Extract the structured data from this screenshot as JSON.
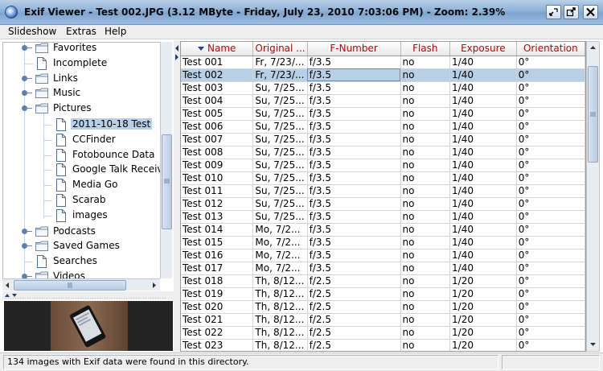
{
  "window": {
    "title": "Exif Viewer - Test 002.JPG  (3.12 MByte  - Friday, July 23, 2010  7:03:06 PM)  - Zoom: 2.39%"
  },
  "menu": {
    "items": [
      "Slideshow",
      "Extras",
      "Help"
    ]
  },
  "tree": {
    "items": [
      {
        "label": "Favorites",
        "type": "folder",
        "level": 0
      },
      {
        "label": "Incomplete",
        "type": "doc",
        "level": 0
      },
      {
        "label": "Links",
        "type": "folder",
        "level": 0
      },
      {
        "label": "Music",
        "type": "folder",
        "level": 0
      },
      {
        "label": "Pictures",
        "type": "folder",
        "level": 0
      },
      {
        "label": "2011-10-18 Test",
        "type": "doc",
        "level": 1,
        "selected": true
      },
      {
        "label": "CCFinder",
        "type": "doc",
        "level": 1
      },
      {
        "label": "Fotobounce Data",
        "type": "doc",
        "level": 1
      },
      {
        "label": "Google Talk Receive",
        "type": "doc",
        "level": 1
      },
      {
        "label": "Media Go",
        "type": "doc",
        "level": 1
      },
      {
        "label": "Scarab",
        "type": "doc",
        "level": 1
      },
      {
        "label": "images",
        "type": "doc",
        "level": 1
      },
      {
        "label": "Podcasts",
        "type": "folder",
        "level": 0
      },
      {
        "label": "Saved Games",
        "type": "folder",
        "level": 0
      },
      {
        "label": "Searches",
        "type": "doc",
        "level": 0
      },
      {
        "label": "Videos",
        "type": "folder",
        "level": 0
      }
    ]
  },
  "table": {
    "columns": [
      "Name",
      "Original ...",
      "F-Number",
      "Flash",
      "Exposure",
      "Orientation"
    ],
    "sorted_column": "Name",
    "selected_row": 1,
    "rows": [
      [
        "Test 001",
        "Fr, 7/23/...",
        "f/3.5",
        "no",
        "1/40",
        "0°"
      ],
      [
        "Test 002",
        "Fr, 7/23/...",
        "f/3.5",
        "no",
        "1/40",
        "0°"
      ],
      [
        "Test 003",
        "Su, 7/25...",
        "f/3.5",
        "no",
        "1/40",
        "0°"
      ],
      [
        "Test 004",
        "Su, 7/25...",
        "f/3.5",
        "no",
        "1/40",
        "0°"
      ],
      [
        "Test 005",
        "Su, 7/25...",
        "f/3.5",
        "no",
        "1/40",
        "0°"
      ],
      [
        "Test 006",
        "Su, 7/25...",
        "f/3.5",
        "no",
        "1/40",
        "0°"
      ],
      [
        "Test 007",
        "Su, 7/25...",
        "f/3.5",
        "no",
        "1/40",
        "0°"
      ],
      [
        "Test 008",
        "Su, 7/25...",
        "f/3.5",
        "no",
        "1/40",
        "0°"
      ],
      [
        "Test 009",
        "Su, 7/25...",
        "f/3.5",
        "no",
        "1/40",
        "0°"
      ],
      [
        "Test 010",
        "Su, 7/25...",
        "f/3.5",
        "no",
        "1/40",
        "0°"
      ],
      [
        "Test 011",
        "Su, 7/25...",
        "f/3.5",
        "no",
        "1/40",
        "0°"
      ],
      [
        "Test 012",
        "Su, 7/25...",
        "f/3.5",
        "no",
        "1/40",
        "0°"
      ],
      [
        "Test 013",
        "Su, 7/25...",
        "f/3.5",
        "no",
        "1/40",
        "0°"
      ],
      [
        "Test 014",
        "Mo, 7/2...",
        "f/3.5",
        "no",
        "1/40",
        "0°"
      ],
      [
        "Test 015",
        "Mo, 7/2...",
        "f/3.5",
        "no",
        "1/40",
        "0°"
      ],
      [
        "Test 016",
        "Mo, 7/2...",
        "f/3.5",
        "no",
        "1/40",
        "0°"
      ],
      [
        "Test 017",
        "Mo, 7/2...",
        "f/3.5",
        "no",
        "1/40",
        "0°"
      ],
      [
        "Test 018",
        "Th, 8/12...",
        "f/2.5",
        "no",
        "1/20",
        "0°"
      ],
      [
        "Test 019",
        "Th, 8/12...",
        "f/2.5",
        "no",
        "1/20",
        "0°"
      ],
      [
        "Test 020",
        "Th, 8/12...",
        "f/2.5",
        "no",
        "1/20",
        "0°"
      ],
      [
        "Test 021",
        "Th, 8/12...",
        "f/2.5",
        "no",
        "1/20",
        "0°"
      ],
      [
        "Test 022",
        "Th, 8/12...",
        "f/2.5",
        "no",
        "1/20",
        "0°"
      ],
      [
        "Test 023",
        "Th, 8/12...",
        "f/2.5",
        "no",
        "1/20",
        "0°"
      ]
    ]
  },
  "status": {
    "text": "134 images with Exif data were found in this directory."
  },
  "colors": {
    "header_text": "#c00000",
    "selection": "#b8cfe5",
    "title_bar": "#8fb1d8"
  }
}
